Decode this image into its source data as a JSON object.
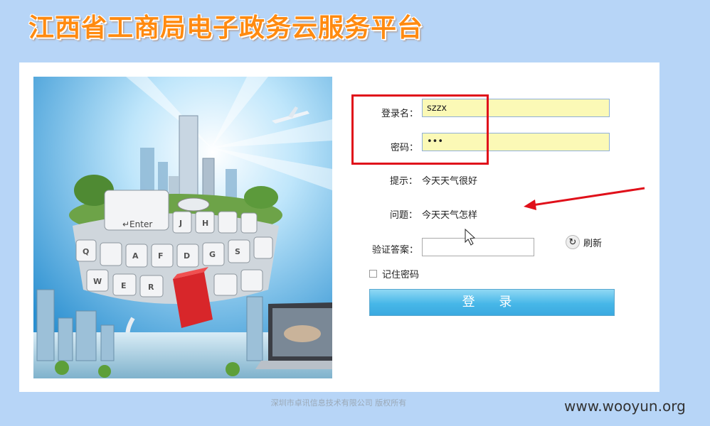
{
  "header": {
    "title": "江西省工商局电子政务云服务平台"
  },
  "hero": {
    "enter_key_label": "↵Enter",
    "keys": [
      "J",
      "H",
      "D",
      "G",
      "F",
      "A",
      "S",
      "Q",
      "W",
      "E",
      "R"
    ]
  },
  "form": {
    "username_label": "登录名：",
    "username_value": "szzx",
    "password_label": "密码：",
    "password_value": "•••",
    "hint_label": "提示：",
    "hint_value": "今天天气很好",
    "question_label": "问题：",
    "question_value": "今天天气怎样",
    "captcha_label": "验证答案：",
    "captcha_value": "",
    "refresh_label": "刷新",
    "remember_label": "记住密码",
    "login_button": "登 录"
  },
  "footer": {
    "copyright": "深圳市卓讯信息技术有限公司  版权所有"
  },
  "watermark": {
    "text": "www.wooyun.org"
  },
  "colors": {
    "background": "#b7d5f7",
    "title": "#ff8a10",
    "input_fill": "#fbf9b6",
    "highlight": "#e0101a",
    "button": "#47b7e8"
  }
}
